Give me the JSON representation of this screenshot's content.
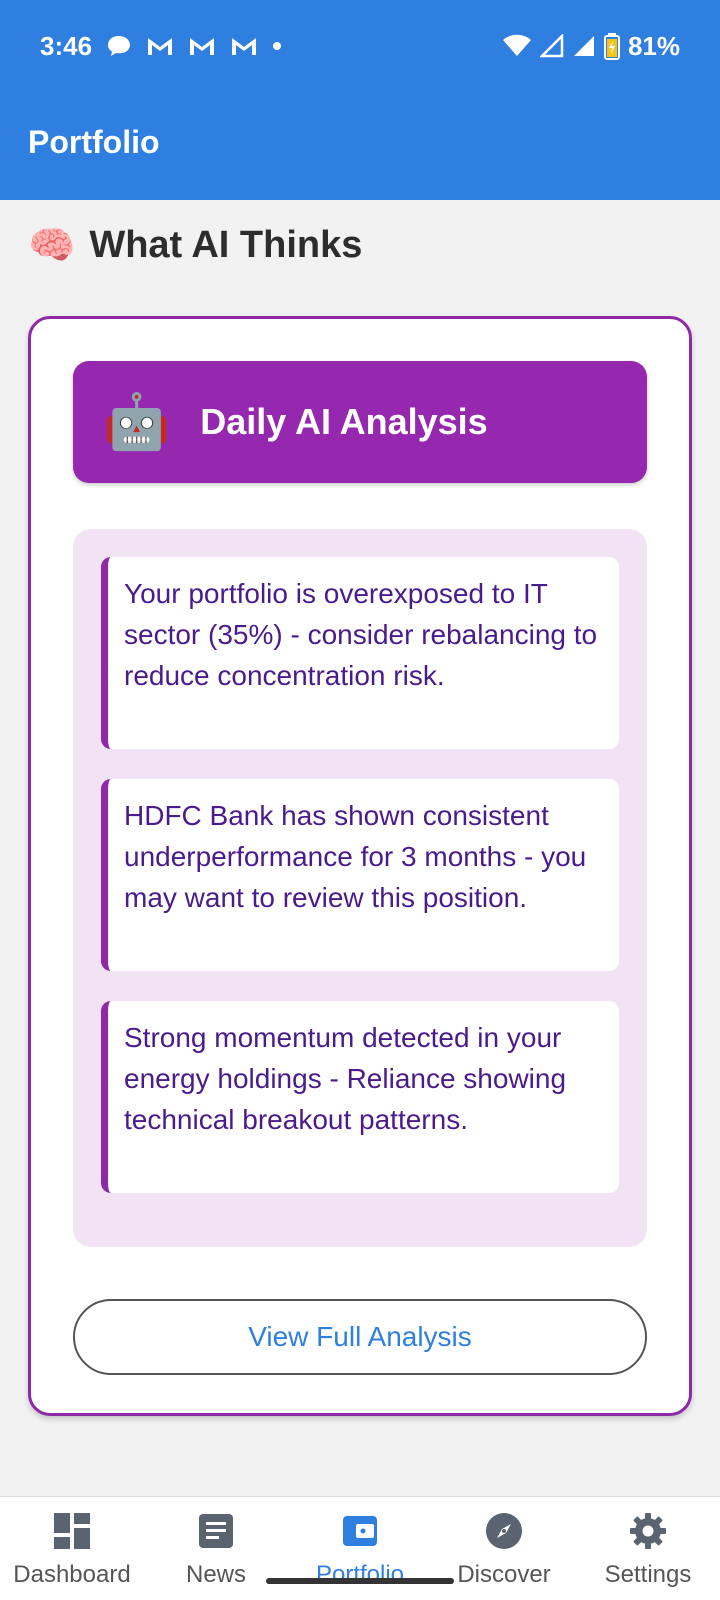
{
  "status": {
    "time": "3:46",
    "battery": "81%"
  },
  "header": {
    "title": "Portfolio"
  },
  "section": {
    "emoji": "🧠",
    "title": "What AI Thinks"
  },
  "card": {
    "banner_emoji": "🤖",
    "banner_title": "Daily AI Analysis",
    "insights": [
      "Your portfolio is overexposed to IT sector (35%) - consider rebalancing to reduce concentration risk.",
      "HDFC Bank has shown consistent underperformance for 3 months - you may want to review this position.",
      "Strong momentum detected in your energy holdings - Reliance showing technical breakout patterns."
    ],
    "button_label": "View Full Analysis"
  },
  "nav": {
    "items": [
      {
        "label": "Dashboard",
        "icon": "dashboard-icon"
      },
      {
        "label": "News",
        "icon": "news-icon"
      },
      {
        "label": "Portfolio",
        "icon": "wallet-icon"
      },
      {
        "label": "Discover",
        "icon": "compass-icon"
      },
      {
        "label": "Settings",
        "icon": "gear-icon"
      }
    ],
    "active_index": 2
  },
  "colors": {
    "primary": "#2f7fe0",
    "accent": "#9528ae",
    "insight_text": "#4a1b8c"
  }
}
